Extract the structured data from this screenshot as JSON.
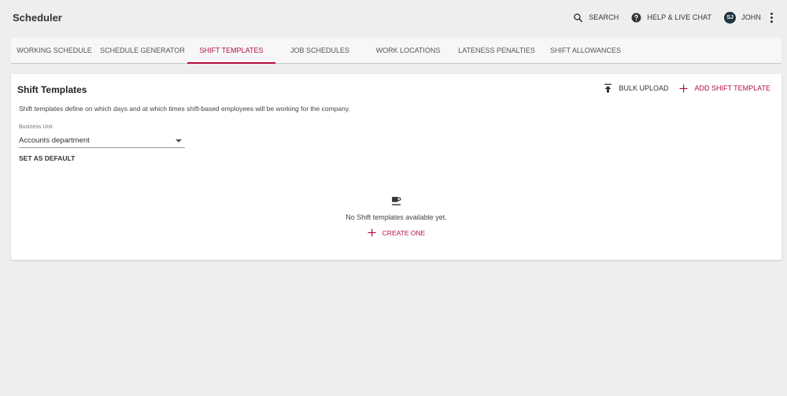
{
  "app": {
    "title": "Scheduler"
  },
  "topbar": {
    "search_label": "SEARCH",
    "help_label": "HELP & LIVE CHAT",
    "user_initials": "SJ",
    "user_name": "JOHN"
  },
  "tabs": [
    {
      "label": "WORKING SCHEDULE",
      "active": false
    },
    {
      "label": "SCHEDULE GENERATOR",
      "active": false
    },
    {
      "label": "SHIFT TEMPLATES",
      "active": true
    },
    {
      "label": "JOB SCHEDULES",
      "active": false
    },
    {
      "label": "WORK LOCATIONS",
      "active": false
    },
    {
      "label": "LATENESS PENALTIES",
      "active": false
    },
    {
      "label": "SHIFT ALLOWANCES",
      "active": false
    }
  ],
  "card": {
    "title": "Shift Templates",
    "bulk_upload_label": "BULK UPLOAD",
    "add_label": "ADD SHIFT TEMPLATE",
    "description": "Shift templates define on which days and at which times shift-based employees will be working for the company.",
    "business_unit_label": "Business Unit",
    "business_unit_value": "Accounts department",
    "set_default_label": "SET AS DEFAULT",
    "empty_text": "No Shift templates available yet.",
    "create_one_label": "CREATE ONE"
  },
  "colors": {
    "accent": "#b5103f",
    "background": "#eeeeee",
    "avatar": "#1f3340"
  },
  "icons": [
    "search-icon",
    "help-icon",
    "more-vert-icon",
    "upload-icon",
    "plus-icon",
    "coffee-icon",
    "caret-down-icon"
  ]
}
